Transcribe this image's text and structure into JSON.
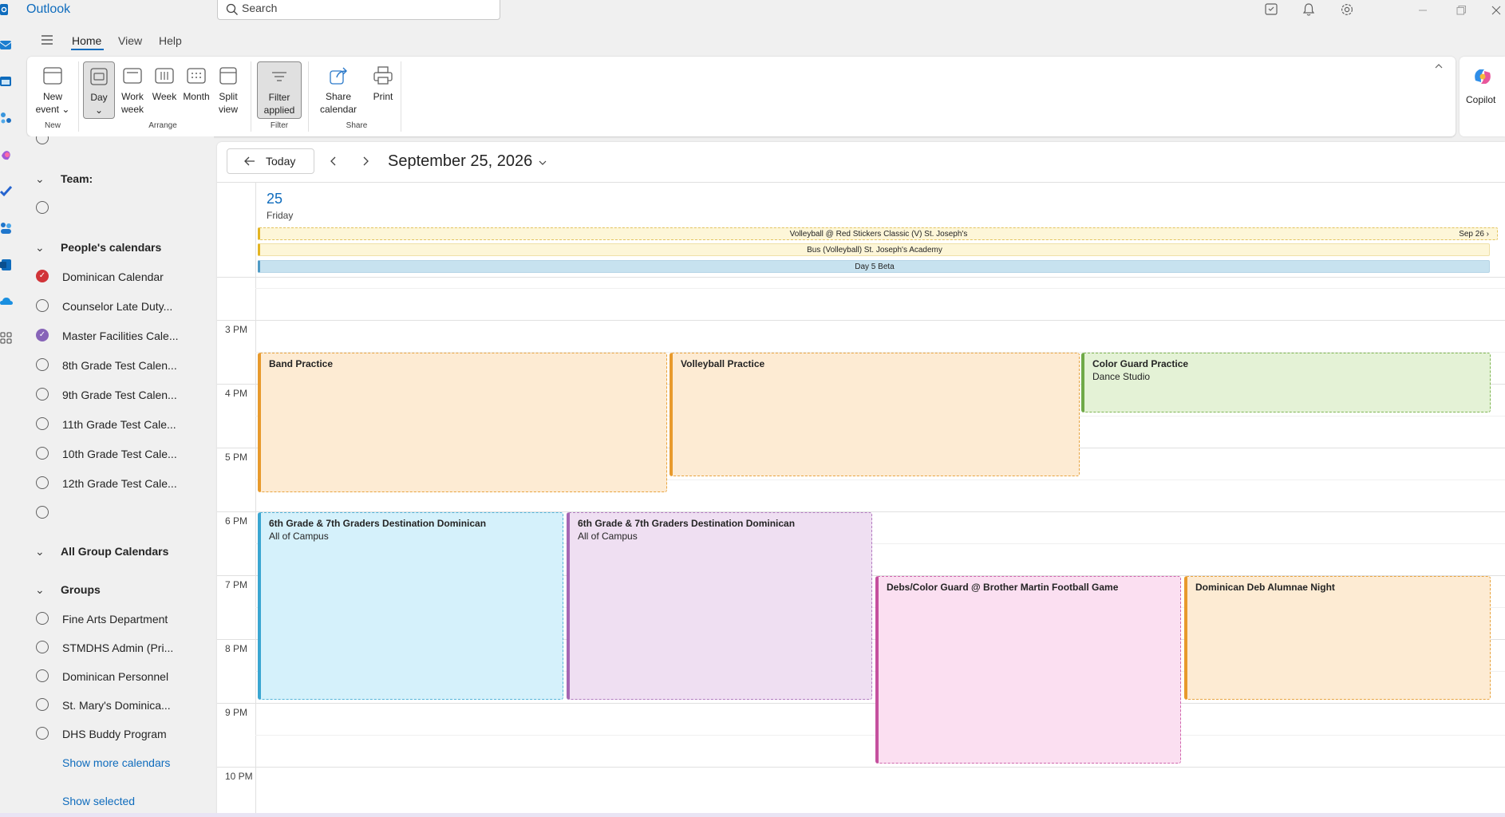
{
  "app": {
    "name": "Outlook"
  },
  "search": {
    "placeholder": "Search"
  },
  "menu": {
    "tabs": [
      "Home",
      "View",
      "Help"
    ]
  },
  "ribbon": {
    "new_event": "New event",
    "day": "Day",
    "work_week": "Work week",
    "week": "Week",
    "month": "Month",
    "split_view": "Split view",
    "filter_applied": "Filter applied",
    "share_calendar": "Share calendar",
    "print": "Print",
    "copilot": "Copilot",
    "groups": {
      "new": "New",
      "arrange": "Arrange",
      "filter": "Filter",
      "share": "Share"
    }
  },
  "folder_pane": {
    "team_header": "Team:",
    "people_header": "People's calendars",
    "people": [
      {
        "label": "Dominican Calendar",
        "checked": true,
        "color": "#d13438"
      },
      {
        "label": "Counselor Late Duty...",
        "checked": false
      },
      {
        "label": "Master Facilities Cale...",
        "checked": true,
        "color": "#8764b8"
      },
      {
        "label": "8th Grade Test Calen...",
        "checked": false
      },
      {
        "label": "9th Grade Test Calen...",
        "checked": false
      },
      {
        "label": "11th Grade Test Cale...",
        "checked": false
      },
      {
        "label": "10th Grade Test Cale...",
        "checked": false
      },
      {
        "label": "12th Grade Test Cale...",
        "checked": false
      }
    ],
    "all_group_header": "All Group Calendars",
    "groups_header": "Groups",
    "groups": [
      "Fine Arts Department",
      "STMDHS Admin (Pri...",
      "Dominican Personnel",
      "St. Mary's Dominica...",
      "DHS Buddy Program"
    ],
    "show_more": "Show more calendars",
    "show_selected": "Show selected"
  },
  "calendar": {
    "today_label": "Today",
    "date_title": "September 25, 2026",
    "day_number": "25",
    "day_name": "Friday",
    "all_day_events": [
      {
        "title": "Volleyball @ Red Stickers Classic (V) St. Joseph's",
        "continues": "Sep 26"
      },
      {
        "title": "Bus (Volleyball) St. Joseph's Academy"
      },
      {
        "title": "Day 5 Beta"
      }
    ],
    "hour_labels": [
      "3 PM",
      "4 PM",
      "5 PM",
      "6 PM",
      "7 PM",
      "8 PM",
      "9 PM",
      "10 PM"
    ],
    "events": [
      {
        "title": "Band Practice",
        "location": ""
      },
      {
        "title": "Volleyball Practice",
        "location": ""
      },
      {
        "title": "Color Guard Practice",
        "location": "Dance Studio"
      },
      {
        "title": "6th Grade & 7th Graders Destination Dominican",
        "location": "All of Campus"
      },
      {
        "title": "6th Grade & 7th Graders Destination Dominican",
        "location": "All of Campus"
      },
      {
        "title": "Debs/Color Guard @ Brother Martin Football Game",
        "location": ""
      },
      {
        "title": "Dominican Deb Alumnae Night",
        "location": ""
      }
    ]
  },
  "colors": {
    "accent": "#0f6cbd"
  }
}
